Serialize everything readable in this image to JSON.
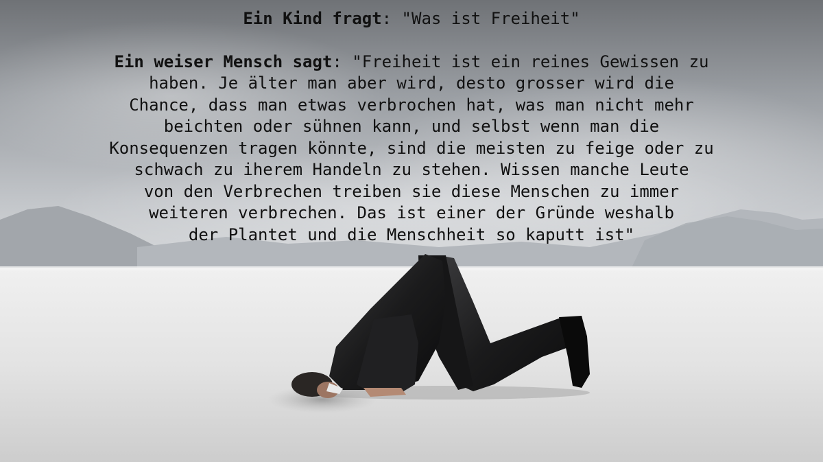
{
  "image": {
    "subject": "man-head-in-sand",
    "colors": {
      "sky_top": "#6f7276",
      "sky_mid": "#9a9ea3",
      "sky_horizon": "#d2d4d7",
      "mountains": "#a9adb2",
      "ground": "#e4e4e4",
      "suit": "#1b1b1c",
      "text": "#111111"
    }
  },
  "quote": {
    "speaker1": "Ein Kind fragt",
    "line1": ": \"Was ist Freiheit\"",
    "speaker2": "Ein weiser Mensch sagt",
    "lines": [
      ": \"Freiheit ist ein reines Gewissen zu",
      "haben. Je älter man aber wird, desto grosser wird die",
      "Chance, dass man etwas verbrochen hat, was man nicht mehr",
      "beichten oder sühnen kann, und selbst wenn man die",
      "Konsequenzen tragen könnte, sind die meisten zu feige oder zu",
      "schwach zu iherem Handeln zu stehen. Wissen manche Leute",
      "von den Verbrechen treiben sie diese Menschen zu immer",
      "weiteren verbrechen. Das ist einer der Gründe weshalb",
      "der Plantet und die Menschheit so kaputt ist\""
    ]
  }
}
